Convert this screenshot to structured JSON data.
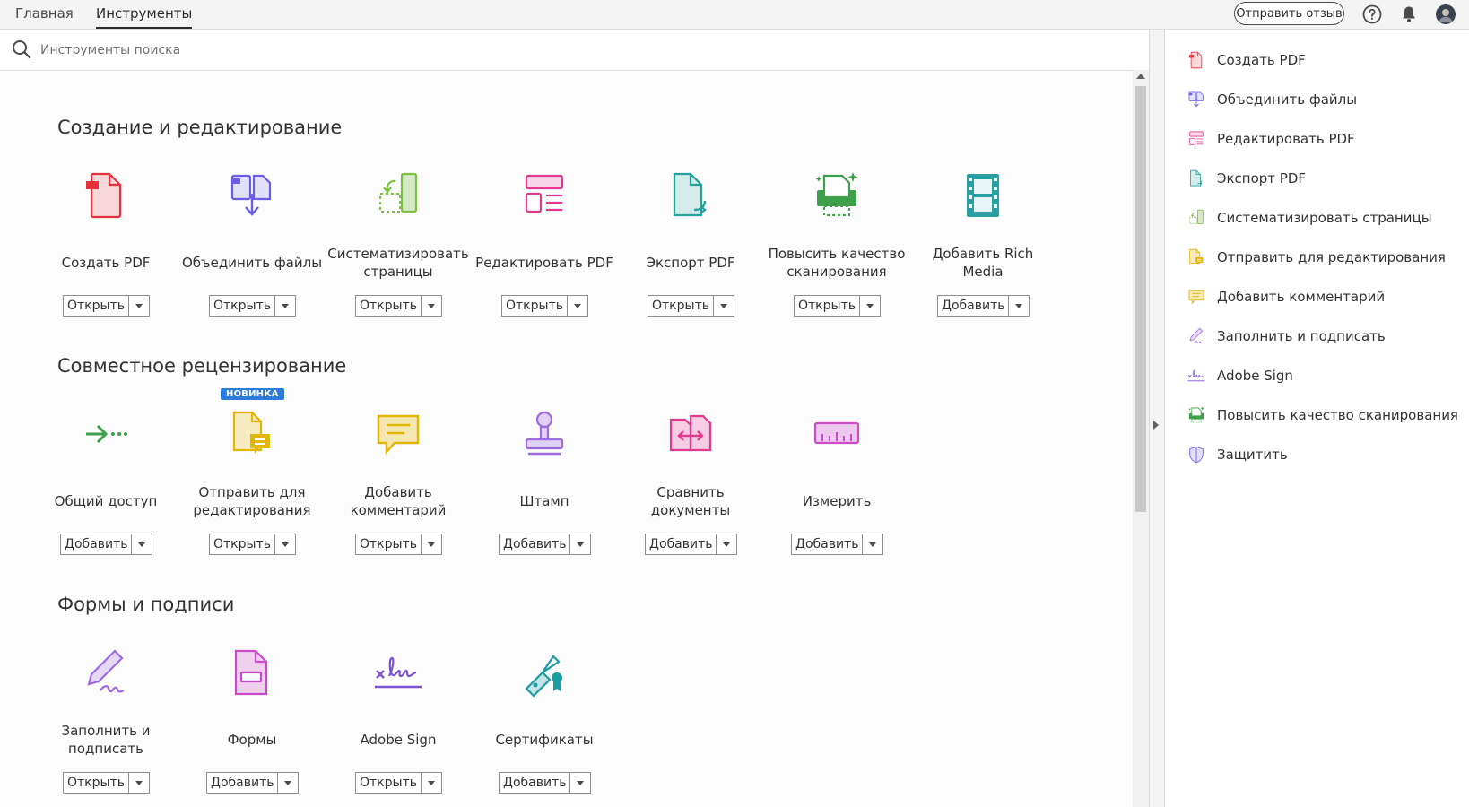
{
  "topbar": {
    "tabs": [
      "Главная",
      "Инструменты"
    ],
    "feedback_label": "Отправить отзыв",
    "help_icon": "help-icon",
    "bell_icon": "bell-icon",
    "avatar_icon": "avatar"
  },
  "search": {
    "placeholder": "Инструменты поиска"
  },
  "sections": [
    {
      "title": "Создание и редактирование",
      "tools": [
        {
          "label": "Создать PDF",
          "button": "Открыть",
          "icon": "create-pdf-icon"
        },
        {
          "label": "Объединить файлы",
          "button": "Открыть",
          "icon": "combine-files-icon"
        },
        {
          "label": "Систематизировать страницы",
          "button": "Открыть",
          "icon": "organize-pages-icon"
        },
        {
          "label": "Редактировать PDF",
          "button": "Открыть",
          "icon": "edit-pdf-icon"
        },
        {
          "label": "Экспорт PDF",
          "button": "Открыть",
          "icon": "export-pdf-icon"
        },
        {
          "label": "Повысить качество сканирования",
          "button": "Открыть",
          "icon": "enhance-scans-icon"
        },
        {
          "label": "Добавить Rich Media",
          "button": "Добавить",
          "icon": "rich-media-icon"
        }
      ]
    },
    {
      "title": "Совместное рецензирование",
      "tools": [
        {
          "label": "Общий доступ",
          "button": "Добавить",
          "icon": "share-icon"
        },
        {
          "label": "Отправить для редактирования",
          "button": "Открыть",
          "icon": "send-for-comments-icon",
          "badge": "НОВИНКА"
        },
        {
          "label": "Добавить комментарий",
          "button": "Открыть",
          "icon": "comment-icon"
        },
        {
          "label": "Штамп",
          "button": "Добавить",
          "icon": "stamp-icon"
        },
        {
          "label": "Сравнить документы",
          "button": "Добавить",
          "icon": "compare-icon"
        },
        {
          "label": "Измерить",
          "button": "Добавить",
          "icon": "measure-icon"
        }
      ]
    },
    {
      "title": "Формы и подписи",
      "tools": [
        {
          "label": "Заполнить и подписать",
          "button": "Открыть",
          "icon": "fill-sign-icon"
        },
        {
          "label": "Формы",
          "button": "Добавить",
          "icon": "forms-icon"
        },
        {
          "label": "Adobe Sign",
          "button": "Открыть",
          "icon": "adobe-sign-icon"
        },
        {
          "label": "Сертификаты",
          "button": "Добавить",
          "icon": "certificates-icon"
        }
      ]
    }
  ],
  "right_pane": [
    {
      "label": "Создать PDF",
      "icon": "create-pdf-icon"
    },
    {
      "label": "Объединить файлы",
      "icon": "combine-files-icon"
    },
    {
      "label": "Редактировать PDF",
      "icon": "edit-pdf-icon"
    },
    {
      "label": "Экспорт PDF",
      "icon": "export-pdf-icon"
    },
    {
      "label": "Систематизировать страницы",
      "icon": "organize-pages-icon"
    },
    {
      "label": "Отправить для редактирования",
      "icon": "send-for-comments-icon"
    },
    {
      "label": "Добавить комментарий",
      "icon": "comment-icon"
    },
    {
      "label": "Заполнить и подписать",
      "icon": "fill-sign-icon"
    },
    {
      "label": "Adobe Sign",
      "icon": "adobe-sign-icon"
    },
    {
      "label": "Повысить качество сканирования",
      "icon": "enhance-scans-icon"
    },
    {
      "label": "Защитить",
      "icon": "protect-icon"
    }
  ],
  "colors": {
    "create": "#e5323b",
    "combine": "#6d5ce8",
    "organize": "#7cc142",
    "edit": "#e03a8f",
    "export": "#25a19c",
    "scan": "#3ea04a",
    "rich": "#2a9ea3",
    "share": "#3ea04a",
    "send": "#e2b609",
    "comment": "#e2b609",
    "stamp": "#9d6ae0",
    "compare": "#e03a8f",
    "measure": "#c94bc9",
    "fill": "#9d6ae0",
    "forms": "#c94bc9",
    "sign": "#7a52d6",
    "cert": "#1c9ba0",
    "protect": "#6d5ce8",
    "badge": "#2d7bd8"
  }
}
